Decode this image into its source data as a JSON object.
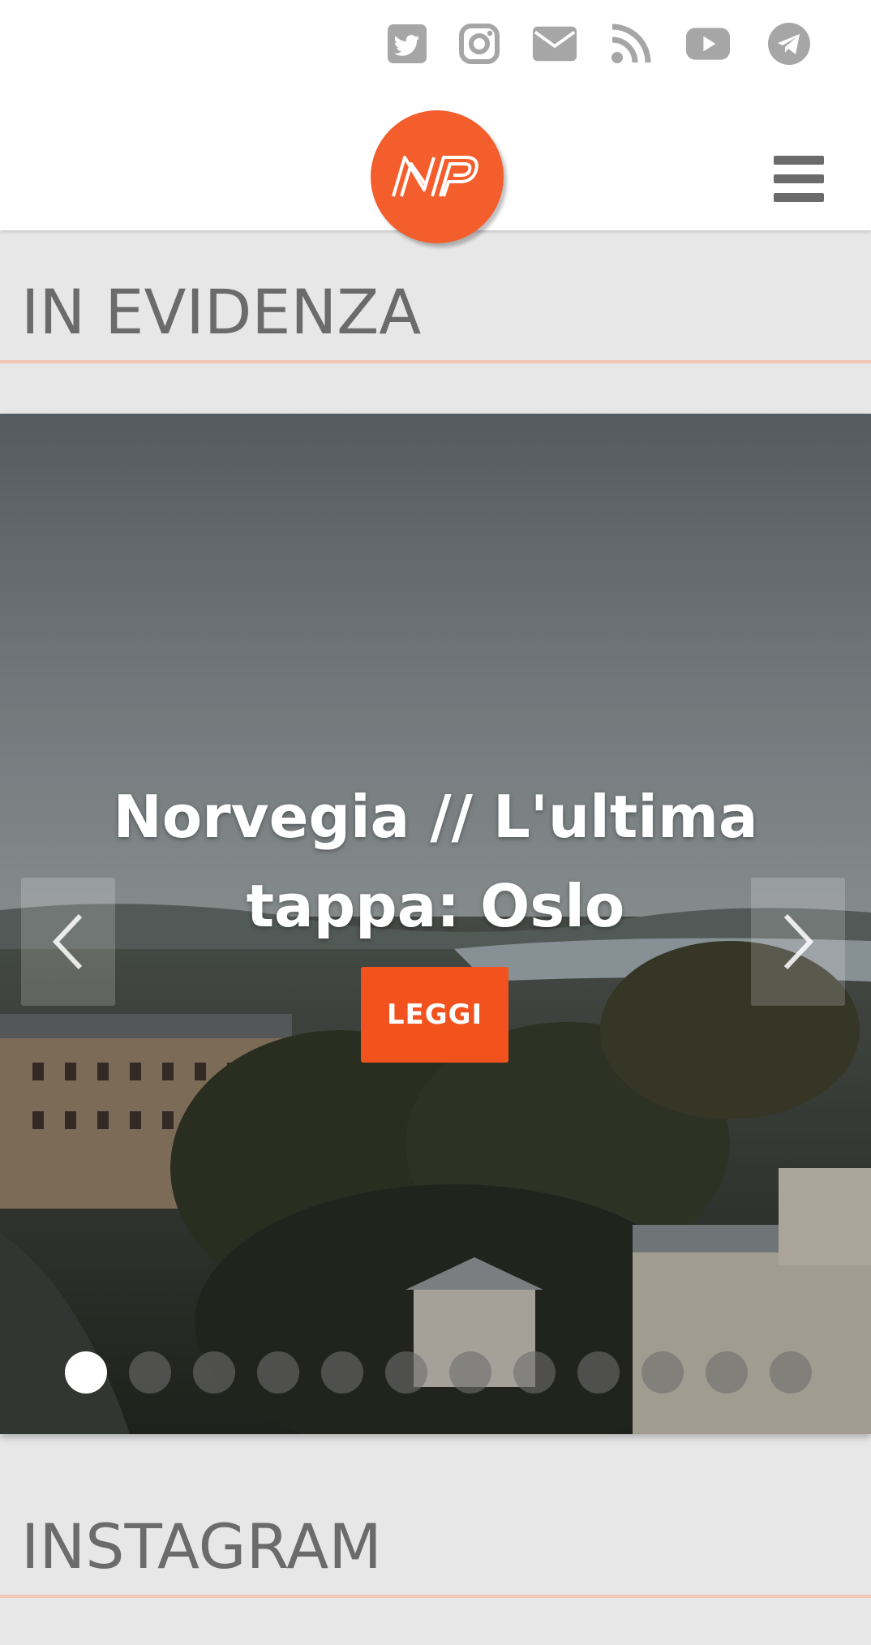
{
  "header": {
    "social": [
      {
        "name": "twitter-icon"
      },
      {
        "name": "instagram-icon"
      },
      {
        "name": "email-icon"
      },
      {
        "name": "rss-icon"
      },
      {
        "name": "youtube-icon"
      },
      {
        "name": "telegram-icon"
      }
    ],
    "logo_text": "NP",
    "icon_color": "#a6a6a6",
    "accent_color": "#f45d2c"
  },
  "sections": {
    "featured_title": "IN EVIDENZA",
    "instagram_title": "INSTAGRAM"
  },
  "slider": {
    "title": "Norvegia // L'ultima tappa: Oslo",
    "button_label": "LEGGI",
    "slide_count": 12,
    "active_index": 0
  }
}
